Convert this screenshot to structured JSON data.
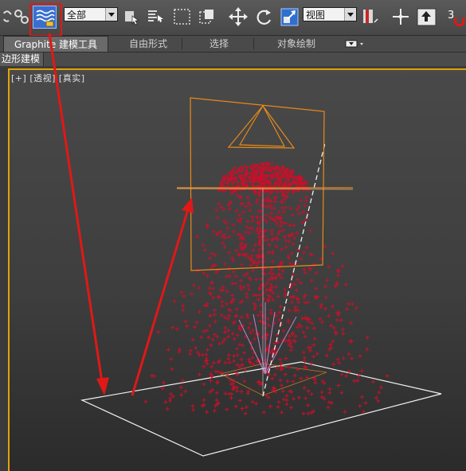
{
  "toolbar": {
    "selection_filter": "全部",
    "ref_coord": "视图",
    "snap_count": "3",
    "icons": [
      "link-icon",
      "unlink-icon",
      "bind-space-warp-icon",
      "select-object-icon",
      "select-by-name-icon",
      "rect-selection-icon",
      "window-crossing-icon",
      "move-icon",
      "rotate-icon",
      "scale-icon",
      "named-selection-icon",
      "pivot-icon",
      "manipulate-icon",
      "snap-icon"
    ]
  },
  "ribbon": {
    "tabs": [
      "Graphite 建模工具",
      "自由形式",
      "选择",
      "对象绘制"
    ],
    "active_tab": "Graphite 建模工具",
    "subpanel": "边形建模"
  },
  "viewport": {
    "label_plus": "[+]",
    "label_view": "[透视]",
    "label_shading": "[真实]"
  },
  "colors": {
    "annotation": "#e01818",
    "selection": "#e88a1a",
    "particles": "#c8102a",
    "active_viewport_border": "#e0a400"
  }
}
